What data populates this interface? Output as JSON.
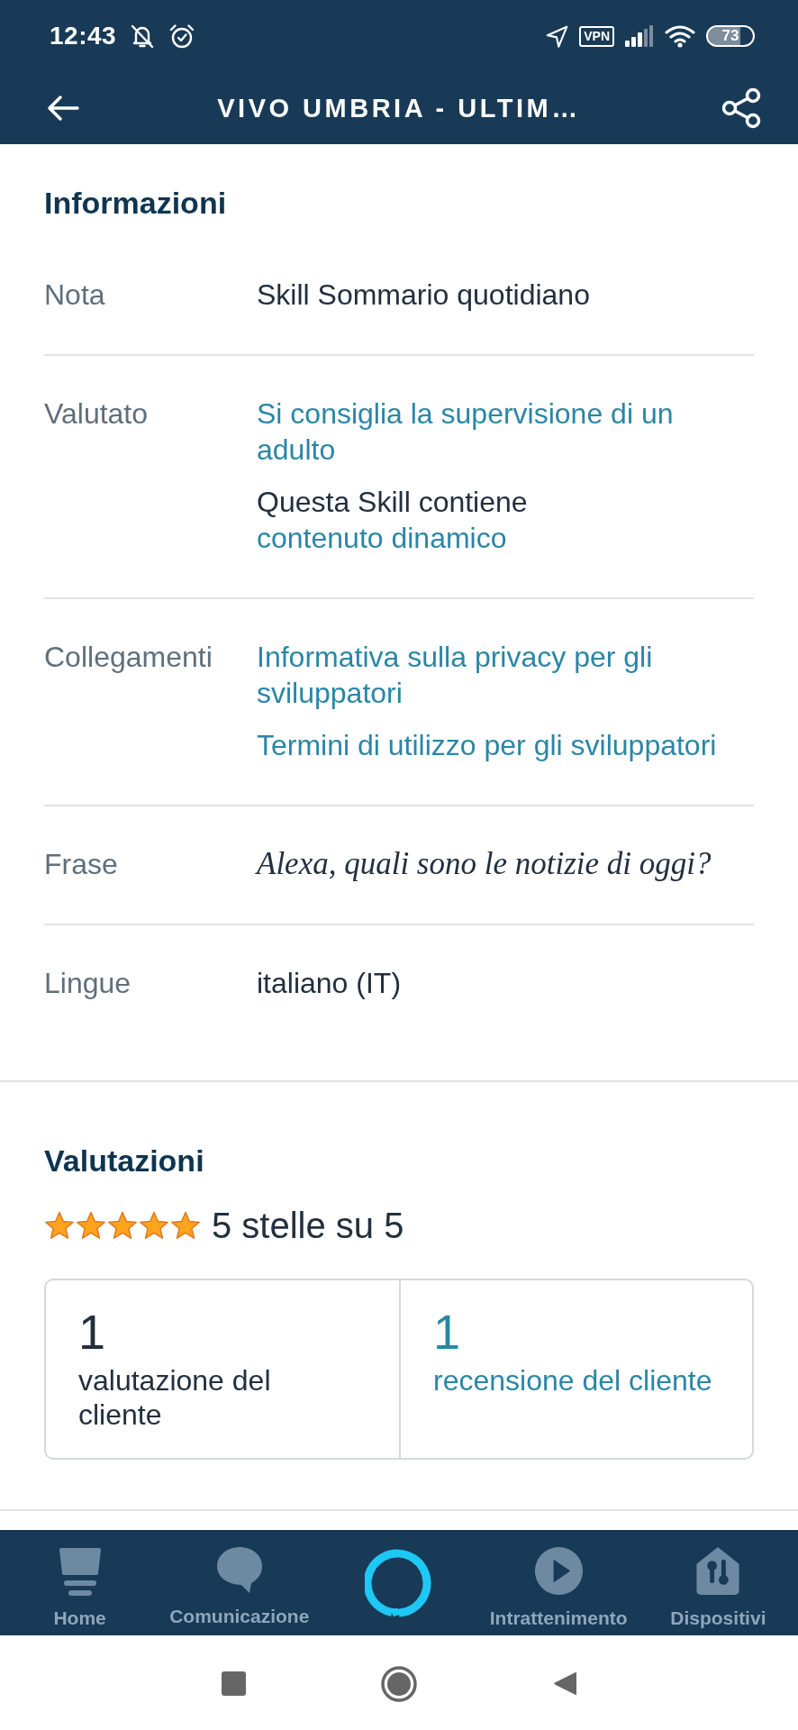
{
  "status_bar": {
    "time": "12:43",
    "vpn": "VPN",
    "battery": "73"
  },
  "header": {
    "title": "VIVO UMBRIA - ULTIM…"
  },
  "information": {
    "title": "Informazioni",
    "rows": [
      {
        "label": "Nota",
        "paragraphs": [
          [
            {
              "kind": "text",
              "text": "Skill Sommario quotidiano"
            }
          ]
        ]
      },
      {
        "label": "Valutato",
        "paragraphs": [
          [
            {
              "kind": "link",
              "text": "Si consiglia la supervisione di un adulto"
            }
          ],
          [
            {
              "kind": "text",
              "text": "Questa Skill contiene"
            },
            {
              "kind": "link",
              "text": "contenuto dinamico"
            }
          ]
        ]
      },
      {
        "label": "Collegamenti",
        "paragraphs": [
          [
            {
              "kind": "link",
              "text": "Informativa sulla privacy per gli sviluppatori"
            }
          ],
          [
            {
              "kind": "link",
              "text": "Termini di utilizzo per gli sviluppatori"
            }
          ]
        ]
      },
      {
        "label": "Frase",
        "paragraphs": [
          [
            {
              "kind": "phrase",
              "text": "Alexa, quali sono le notizie di oggi?"
            }
          ]
        ]
      },
      {
        "label": "Lingue",
        "paragraphs": [
          [
            {
              "kind": "text",
              "text": "italiano (IT)"
            }
          ]
        ]
      }
    ]
  },
  "ratings": {
    "title": "Valutazioni",
    "stars": 5,
    "summary": "5 stelle su 5",
    "stats": [
      {
        "kind": "text",
        "count": "1",
        "label": "valutazione del cliente"
      },
      {
        "kind": "link",
        "count": "1",
        "label": "recensione del cliente"
      }
    ]
  },
  "bottom_nav": [
    {
      "kind": "tab",
      "label": "Home",
      "selected": false
    },
    {
      "kind": "tab",
      "label": "Comunicazione",
      "selected": false
    },
    {
      "kind": "voice"
    },
    {
      "kind": "tab",
      "label": "Intrattenimento",
      "selected": false
    },
    {
      "kind": "tab",
      "label": "Dispositivi",
      "selected": false
    }
  ]
}
